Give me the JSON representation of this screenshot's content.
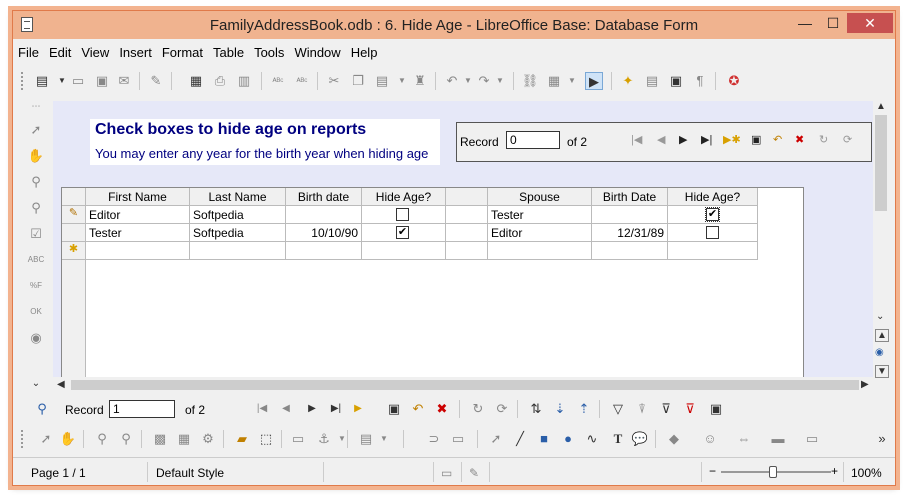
{
  "window": {
    "title": "FamilyAddressBook.odb : 6. Hide Age - LibreOffice Base: Database Form",
    "min_glyph": "—",
    "max_glyph": "☐",
    "close_glyph": "✕"
  },
  "menu": {
    "items": [
      "File",
      "Edit",
      "View",
      "Insert",
      "Format",
      "Table",
      "Tools",
      "Window",
      "Help"
    ]
  },
  "form": {
    "heading": "Check boxes to hide age on reports",
    "subheading": "You may enter any year for the birth year when hiding age",
    "record_label": "Record",
    "record_value": "0",
    "record_of": "of 2"
  },
  "grid": {
    "headers": [
      "First Name",
      "Last Name",
      "Birth date",
      "Hide Age?",
      "",
      "Spouse",
      "Birth Date",
      "Hide Age?"
    ],
    "rows": [
      {
        "marker": "✎",
        "first": "Editor",
        "last": "Softpedia",
        "birth": "",
        "hide": false,
        "spouse": "Tester",
        "spouse_birth": "",
        "spouse_hide": true
      },
      {
        "marker": "",
        "first": "Tester",
        "last": "Softpedia",
        "birth": "10/10/90",
        "hide": true,
        "spouse": "Editor",
        "spouse_birth": "12/31/89",
        "spouse_hide": false
      },
      {
        "marker": "✱",
        "first": "",
        "last": "",
        "birth": "",
        "hide": null,
        "spouse": "",
        "spouse_birth": "",
        "spouse_hide": null
      }
    ]
  },
  "nav": {
    "record_label": "Record",
    "record_value": "1",
    "record_of": "of 2"
  },
  "status": {
    "page": "Page 1 / 1",
    "style": "Default Style",
    "zoom": "100%",
    "zoom_minus": "−",
    "zoom_plus": "+"
  }
}
